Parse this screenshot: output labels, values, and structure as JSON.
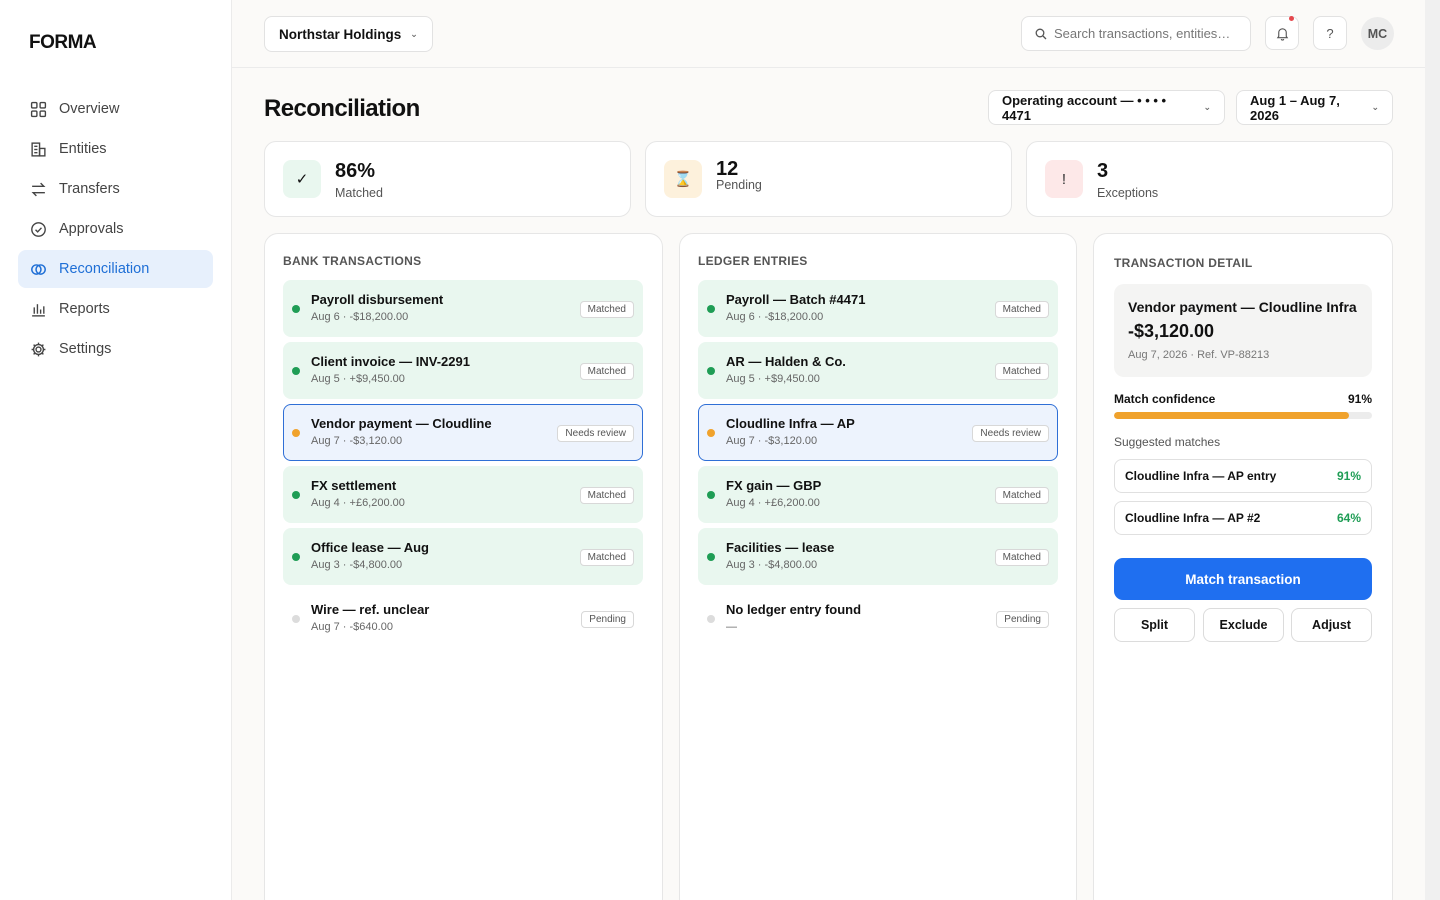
{
  "app": {
    "logo": "FORMA"
  },
  "sidebar": {
    "items": [
      {
        "label": "Overview",
        "icon": "grid-icon"
      },
      {
        "label": "Entities",
        "icon": "building-icon"
      },
      {
        "label": "Transfers",
        "icon": "arrows-icon"
      },
      {
        "label": "Approvals",
        "icon": "check-circle-icon"
      },
      {
        "label": "Reconciliation",
        "icon": "rings-icon",
        "active": true
      },
      {
        "label": "Reports",
        "icon": "bar-chart-icon"
      },
      {
        "label": "Settings",
        "icon": "gear-icon"
      }
    ]
  },
  "header": {
    "org": "Northstar Holdings",
    "search_placeholder": "Search transactions, entities…",
    "help": "?",
    "avatar": "MC"
  },
  "page": {
    "title": "Reconciliation",
    "account_filter": "Operating account — • • • • 4471",
    "date_filter": "Aug 1 – Aug 7, 2026"
  },
  "stats": [
    {
      "value": "86%",
      "label": "Matched",
      "glyph": "✓",
      "color": "#1f9d55"
    },
    {
      "value": "12",
      "label": "Pending",
      "glyph": "⌛",
      "color": "#b7791f"
    },
    {
      "value": "3",
      "label": "Exceptions",
      "glyph": "!",
      "color": "#e5484d"
    }
  ],
  "bank": {
    "title": "BANK TRANSACTIONS",
    "rows": [
      {
        "title": "Payroll disbursement",
        "sub": "Aug 6 · -$18,200.00",
        "status": "Matched"
      },
      {
        "title": "Client invoice — INV-2291",
        "sub": "Aug 5 · +$9,450.00",
        "status": "Matched"
      },
      {
        "title": "Vendor payment — Cloudline",
        "sub": "Aug 7 · -$3,120.00",
        "status": "Needs review"
      },
      {
        "title": "FX settlement",
        "sub": "Aug 4 · +£6,200.00",
        "status": "Matched"
      },
      {
        "title": "Office lease — Aug",
        "sub": "Aug 3 · -$4,800.00",
        "status": "Matched"
      },
      {
        "title": "Wire — ref. unclear",
        "sub": "Aug 7 · -$640.00",
        "status": "Pending"
      }
    ]
  },
  "ledger": {
    "title": "LEDGER ENTRIES",
    "rows": [
      {
        "title": "Payroll — Batch #4471",
        "sub": "Aug 6 · -$18,200.00",
        "status": "Matched"
      },
      {
        "title": "AR — Halden & Co.",
        "sub": "Aug 5 · +$9,450.00",
        "status": "Matched"
      },
      {
        "title": "Cloudline Infra — AP",
        "sub": "Aug 7 · -$3,120.00",
        "status": "Needs review"
      },
      {
        "title": "FX gain — GBP",
        "sub": "Aug 4 · +£6,200.00",
        "status": "Matched"
      },
      {
        "title": "Facilities — lease",
        "sub": "Aug 3 · -$4,800.00",
        "status": "Matched"
      },
      {
        "title": "No ledger entry found",
        "sub": "—",
        "status": "Pending"
      }
    ]
  },
  "detail": {
    "title": "TRANSACTION DETAIL",
    "name": "Vendor payment — Cloudline Infra",
    "amount": "-$3,120.00",
    "meta": "Aug 7, 2026 · Ref. VP-88213",
    "confidence_label": "Match confidence",
    "confidence_value": "91%",
    "confidence": 0.91,
    "suggested_label": "Suggested matches",
    "suggestions": [
      {
        "name": "Cloudline Infra — AP entry",
        "pct": "91%"
      },
      {
        "name": "Cloudline Infra — AP #2",
        "pct": "64%"
      }
    ],
    "primary": "Match transaction",
    "split": "Split",
    "exclude": "Exclude",
    "adjust": "Adjust"
  },
  "colors": {
    "accent": "#1f6ff0",
    "matched": "#1f9d55",
    "review": "#f0a22c",
    "pending": "#dcdcdc"
  }
}
